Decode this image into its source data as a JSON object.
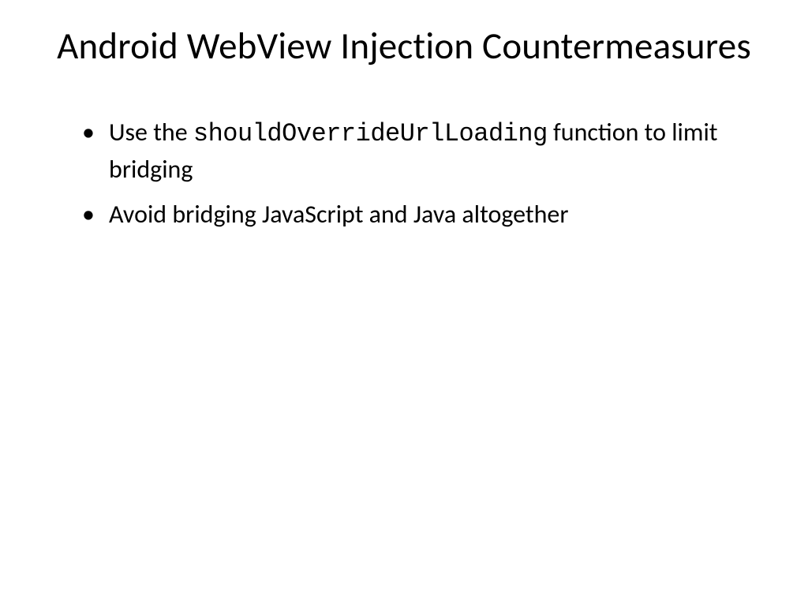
{
  "slide": {
    "title": "Android WebView Injection Countermeasures",
    "bullets": [
      {
        "prefix": "Use the ",
        "code": "shouldOverrideUrlLoading",
        "suffix": " function to limit bridging"
      },
      {
        "text": "Avoid bridging JavaScript and Java altogether"
      }
    ]
  }
}
